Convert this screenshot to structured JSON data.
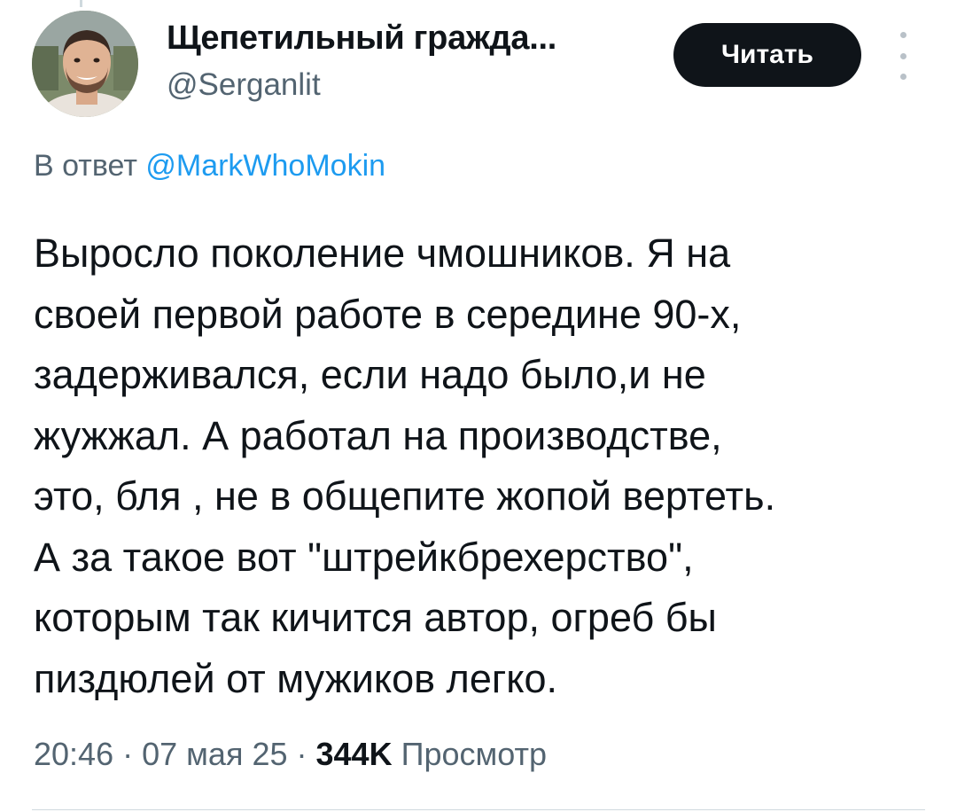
{
  "author": {
    "display_name": "Щепетильный гражда...",
    "handle": "@Serganlit",
    "avatar_icon": "user-photo-avatar"
  },
  "actions": {
    "follow_label": "Читать",
    "more_icon": "more-vertical-icon"
  },
  "reply": {
    "prefix": "В ответ",
    "to": "@MarkWhoMokin"
  },
  "tweet": {
    "lines": [
      "Выросло поколение чмошников. Я на",
      "своей первой работе в середине 90-х,",
      "задерживался, если надо было,и не",
      "жужжал. А работал на производстве,",
      "это, бля , не в общепите жопой вертеть.",
      "А за такое вот \"штрейкбрехерство\",",
      "которым так кичится автор, огреб бы",
      "пиздюлей от мужиков легко."
    ]
  },
  "meta": {
    "time": "20:46",
    "separator": "·",
    "date": "07 мая 25",
    "views_count": "344K",
    "views_label": "Просмотр"
  },
  "colors": {
    "text_primary": "#0f1419",
    "text_secondary": "#536471",
    "link": "#1d9bf0",
    "button_bg": "#0f1419",
    "button_text": "#ffffff"
  }
}
